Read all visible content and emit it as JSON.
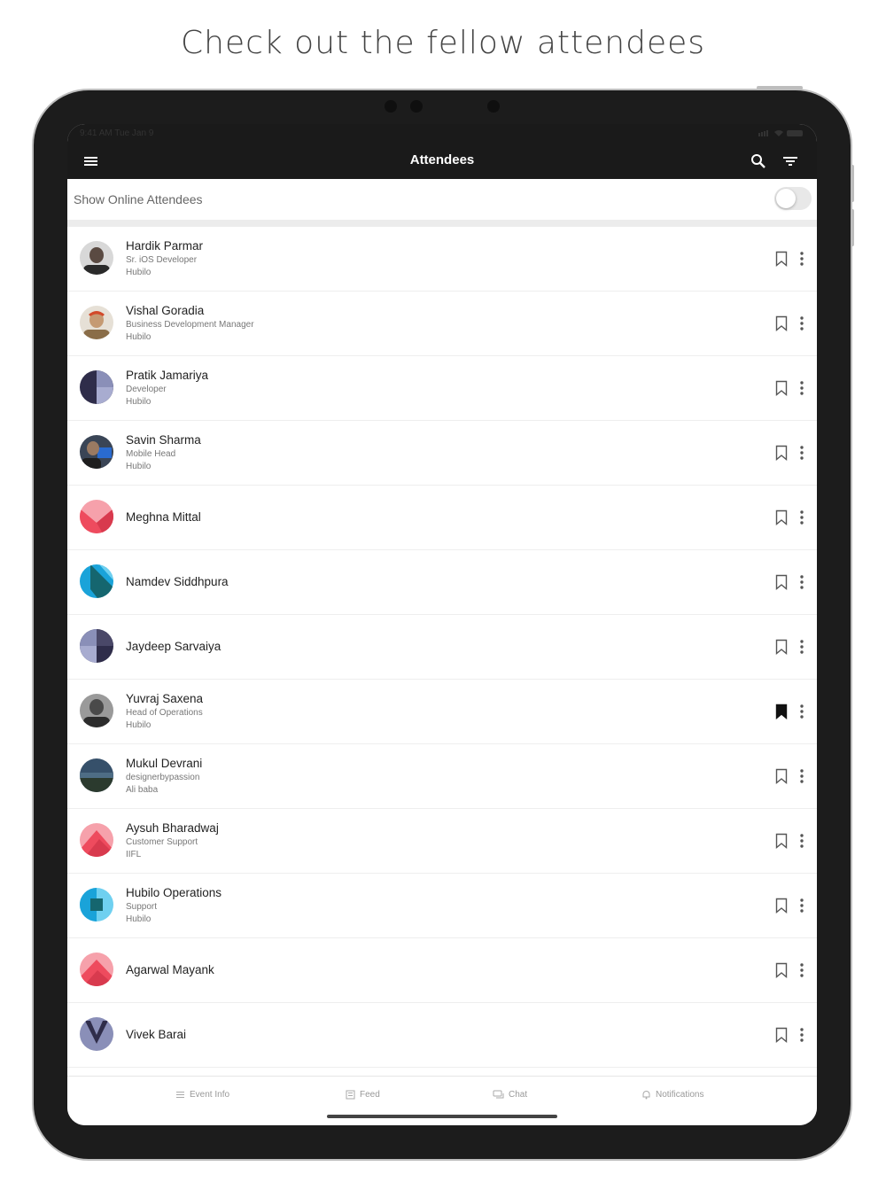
{
  "headline": "Check out the fellow attendees",
  "status_bar": {
    "time": "9:41 AM  Tue Jan 9"
  },
  "nav": {
    "title": "Attendees"
  },
  "online_filter": {
    "label": "Show Online Attendees",
    "enabled": false
  },
  "attendees": [
    {
      "name": "Hardik Parmar",
      "title": "Sr. iOS Developer",
      "company": "Hubilo",
      "bookmarked": false,
      "avatar": "photo"
    },
    {
      "name": "Vishal Goradia",
      "title": "Business Development Manager",
      "company": "Hubilo",
      "bookmarked": false,
      "avatar": "photo"
    },
    {
      "name": "Pratik Jamariya",
      "title": "Developer",
      "company": "Hubilo",
      "bookmarked": false,
      "avatar": "geometric-navy"
    },
    {
      "name": "Savin Sharma",
      "title": "Mobile Head",
      "company": "Hubilo",
      "bookmarked": false,
      "avatar": "photo"
    },
    {
      "name": "Meghna Mittal",
      "title": "",
      "company": "",
      "bookmarked": false,
      "avatar": "geometric-pink"
    },
    {
      "name": "Namdev Siddhpura",
      "title": "",
      "company": "",
      "bookmarked": false,
      "avatar": "geometric-blue"
    },
    {
      "name": "Jaydeep Sarvaiya",
      "title": "",
      "company": "",
      "bookmarked": false,
      "avatar": "geometric-navy"
    },
    {
      "name": "Yuvraj Saxena",
      "title": "Head of Operations",
      "company": "Hubilo",
      "bookmarked": true,
      "avatar": "photo"
    },
    {
      "name": "Mukul Devrani",
      "title": "designerbypassion",
      "company": "Ali baba",
      "bookmarked": false,
      "avatar": "photo"
    },
    {
      "name": "Aysuh Bharadwaj",
      "title": "Customer Support",
      "company": "IIFL",
      "bookmarked": false,
      "avatar": "geometric-pink"
    },
    {
      "name": "Hubilo Operations",
      "title": "Support",
      "company": "Hubilo",
      "bookmarked": false,
      "avatar": "geometric-blue"
    },
    {
      "name": "Agarwal Mayank",
      "title": "",
      "company": "",
      "bookmarked": false,
      "avatar": "geometric-pink"
    },
    {
      "name": "Vivek Barai",
      "title": "",
      "company": "",
      "bookmarked": false,
      "avatar": "geometric-navy"
    }
  ],
  "tabs": [
    {
      "label": "Event Info",
      "icon": "list-icon"
    },
    {
      "label": "Feed",
      "icon": "feed-icon"
    },
    {
      "label": "Chat",
      "icon": "chat-icon"
    },
    {
      "label": "Notifications",
      "icon": "bell-icon"
    }
  ],
  "colors": {
    "nav_bg": "#1a1a1a",
    "bookmark_active": "#111111",
    "pink": "#ee4b5e",
    "blue": "#1aa3d9",
    "navy": "#2f2d4a"
  }
}
